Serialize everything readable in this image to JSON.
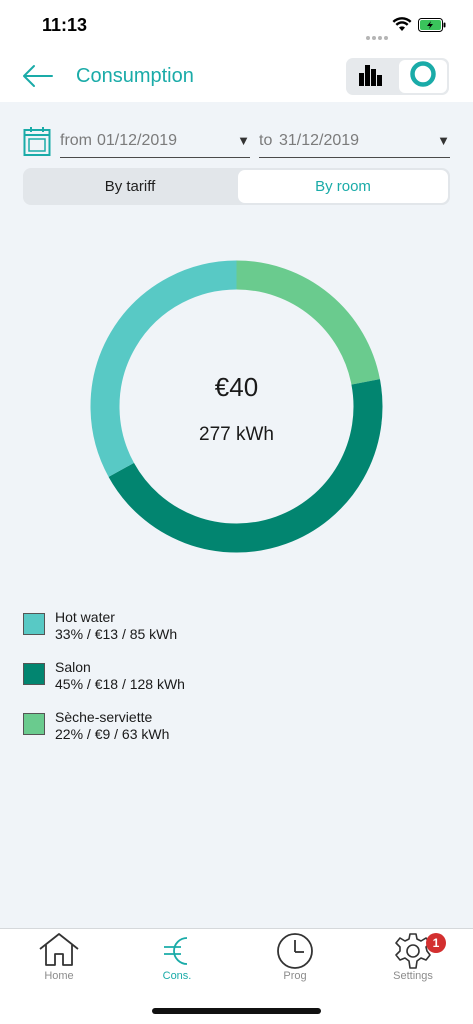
{
  "status_bar": {
    "time": "11:13"
  },
  "header": {
    "title": "Consumption"
  },
  "date_range": {
    "from_prefix": "from",
    "from_value": "01/12/2019",
    "to_prefix": "to",
    "to_value": "31/12/2019",
    "arrow": "▼"
  },
  "segment": {
    "tariff_label": "By tariff",
    "room_label": "By room",
    "selected": "room"
  },
  "chart_data": {
    "type": "pie",
    "center_value": "€40",
    "center_energy": "277 kWh",
    "series": [
      {
        "name": "Hot water",
        "percent": 33,
        "cost": "€13",
        "energy": "85 kWh",
        "color": "#58c9c5"
      },
      {
        "name": "Salon",
        "percent": 45,
        "cost": "€18",
        "energy": "128 kWh",
        "color": "#028570"
      },
      {
        "name": "Sèche-serviette",
        "percent": 22,
        "cost": "€9",
        "energy": "63 kWh",
        "color": "#6acb8e"
      }
    ]
  },
  "legend": [
    {
      "name": "Hot water",
      "detail": "33% / €13 / 85 kWh"
    },
    {
      "name": "Salon",
      "detail": "45% / €18 / 128 kWh"
    },
    {
      "name": "Sèche-serviette",
      "detail": "22% / €9 / 63 kWh"
    }
  ],
  "nav": {
    "home": "Home",
    "cons": "Cons.",
    "prog": "Prog",
    "settings": "Settings",
    "settings_badge": "1",
    "active": "cons"
  },
  "colors": {
    "accent": "#1aaba8",
    "badge": "#d32f2f"
  },
  "icons": {
    "back": "arrow-left-icon",
    "bar_view": "bar-chart-icon",
    "donut_view": "donut-chart-icon",
    "calendar": "calendar-icon",
    "home": "home-icon",
    "cons": "euro-icon",
    "prog": "clock-icon",
    "settings": "gear-icon"
  }
}
